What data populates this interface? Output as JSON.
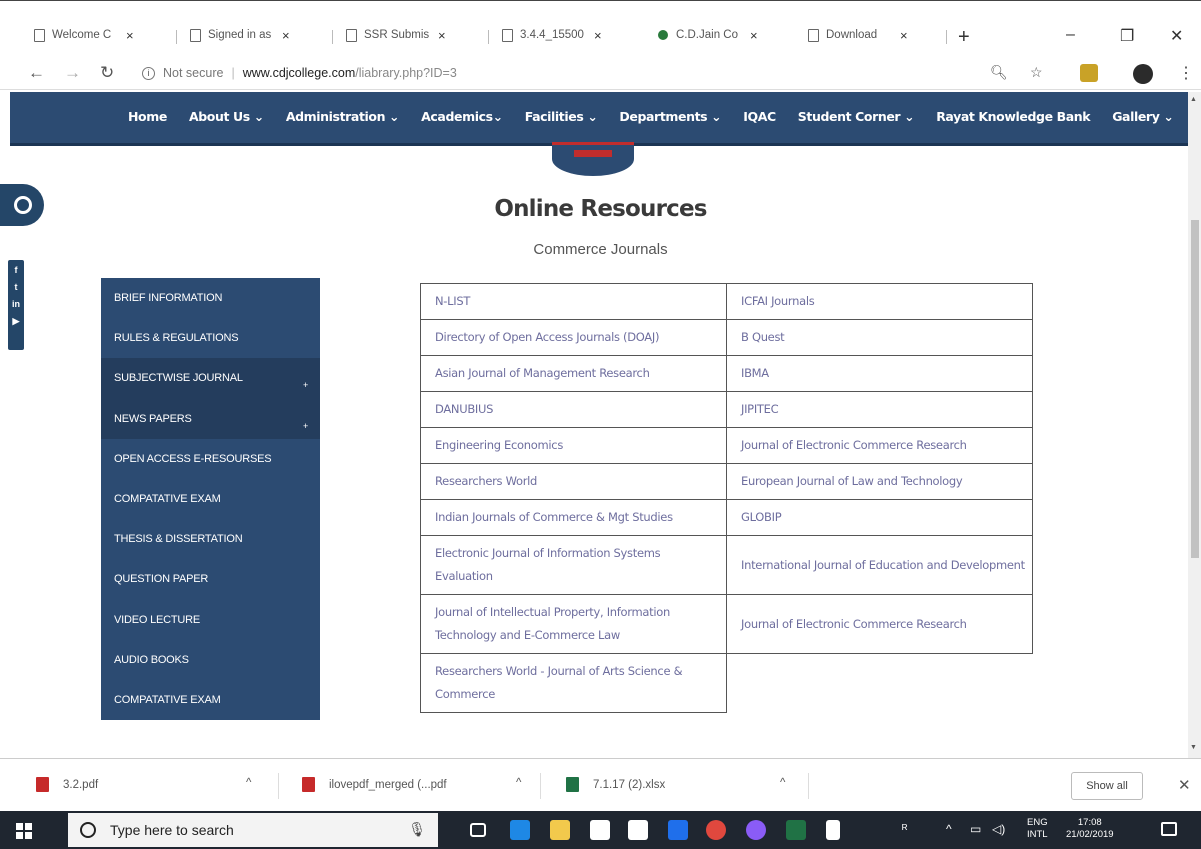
{
  "browser": {
    "tabs": [
      {
        "label": "Welcome C"
      },
      {
        "label": "Signed in as"
      },
      {
        "label": "SSR Submis"
      },
      {
        "label": "3.4.4_15500"
      },
      {
        "label": "C.D.Jain Co"
      },
      {
        "label": "Download"
      }
    ],
    "address": {
      "security": "Not secure",
      "host": "www.cdjcollege.com",
      "path": "/liabrary.php?ID=3"
    }
  },
  "site_nav": {
    "items": [
      "Home",
      "About Us ⌄",
      "Administration ⌄",
      "Academics⌄",
      "Facilities ⌄",
      "Departments ⌄",
      "IQAC",
      "Student Corner ⌄",
      "Rayat Knowledge Bank",
      "Gallery ⌄"
    ]
  },
  "page": {
    "title": "Online Resources",
    "subtitle": "Commerce Journals"
  },
  "sidebar": {
    "items": [
      {
        "label": "BRIEF INFORMATION"
      },
      {
        "label": "RULES & REGULATIONS"
      },
      {
        "label": "SUBJECTWISE JOURNAL"
      },
      {
        "label": "NEWS PAPERS"
      },
      {
        "label": "OPEN ACCESS E-RESOURSES"
      },
      {
        "label": "COMPATATIVE EXAM"
      },
      {
        "label": "THESIS & DISSERTATION"
      },
      {
        "label": "QUESTION PAPER"
      },
      {
        "label": "VIDEO LECTURE"
      },
      {
        "label": "AUDIO BOOKS"
      },
      {
        "label": "COMPATATIVE EXAM"
      }
    ]
  },
  "resources": {
    "rows": [
      [
        "N-LIST",
        "ICFAI Journals"
      ],
      [
        "Directory of Open Access Journals (DOAJ)",
        "B Quest"
      ],
      [
        "Asian Journal of Management Research",
        "IBMA"
      ],
      [
        "DANUBIUS",
        "JIPITEC"
      ],
      [
        "Engineering Economics",
        "Journal of Electronic Commerce Research"
      ],
      [
        "Researchers World",
        "European Journal of Law and Technology"
      ],
      [
        "Indian Journals of Commerce & Mgt Studies",
        "GLOBIP"
      ],
      [
        "Electronic Journal of Information Systems Evaluation",
        "International Journal of Education and Development"
      ],
      [
        "Journal of Intellectual Property, Information Technology and E-Commerce Law",
        "Journal of Electronic Commerce Research"
      ],
      [
        "Researchers World - Journal of Arts Science & Commerce",
        ""
      ]
    ]
  },
  "downloads": {
    "items": [
      {
        "name": "3.2.pdf"
      },
      {
        "name": "ilovepdf_merged (...pdf"
      },
      {
        "name": "7.1.17 (2).xlsx"
      }
    ],
    "show_all": "Show all"
  },
  "taskbar": {
    "search_placeholder": "Type here to search",
    "lang_top": "ENG",
    "lang_bottom": "INTL",
    "time": "17:08",
    "date": "21/02/2019"
  }
}
